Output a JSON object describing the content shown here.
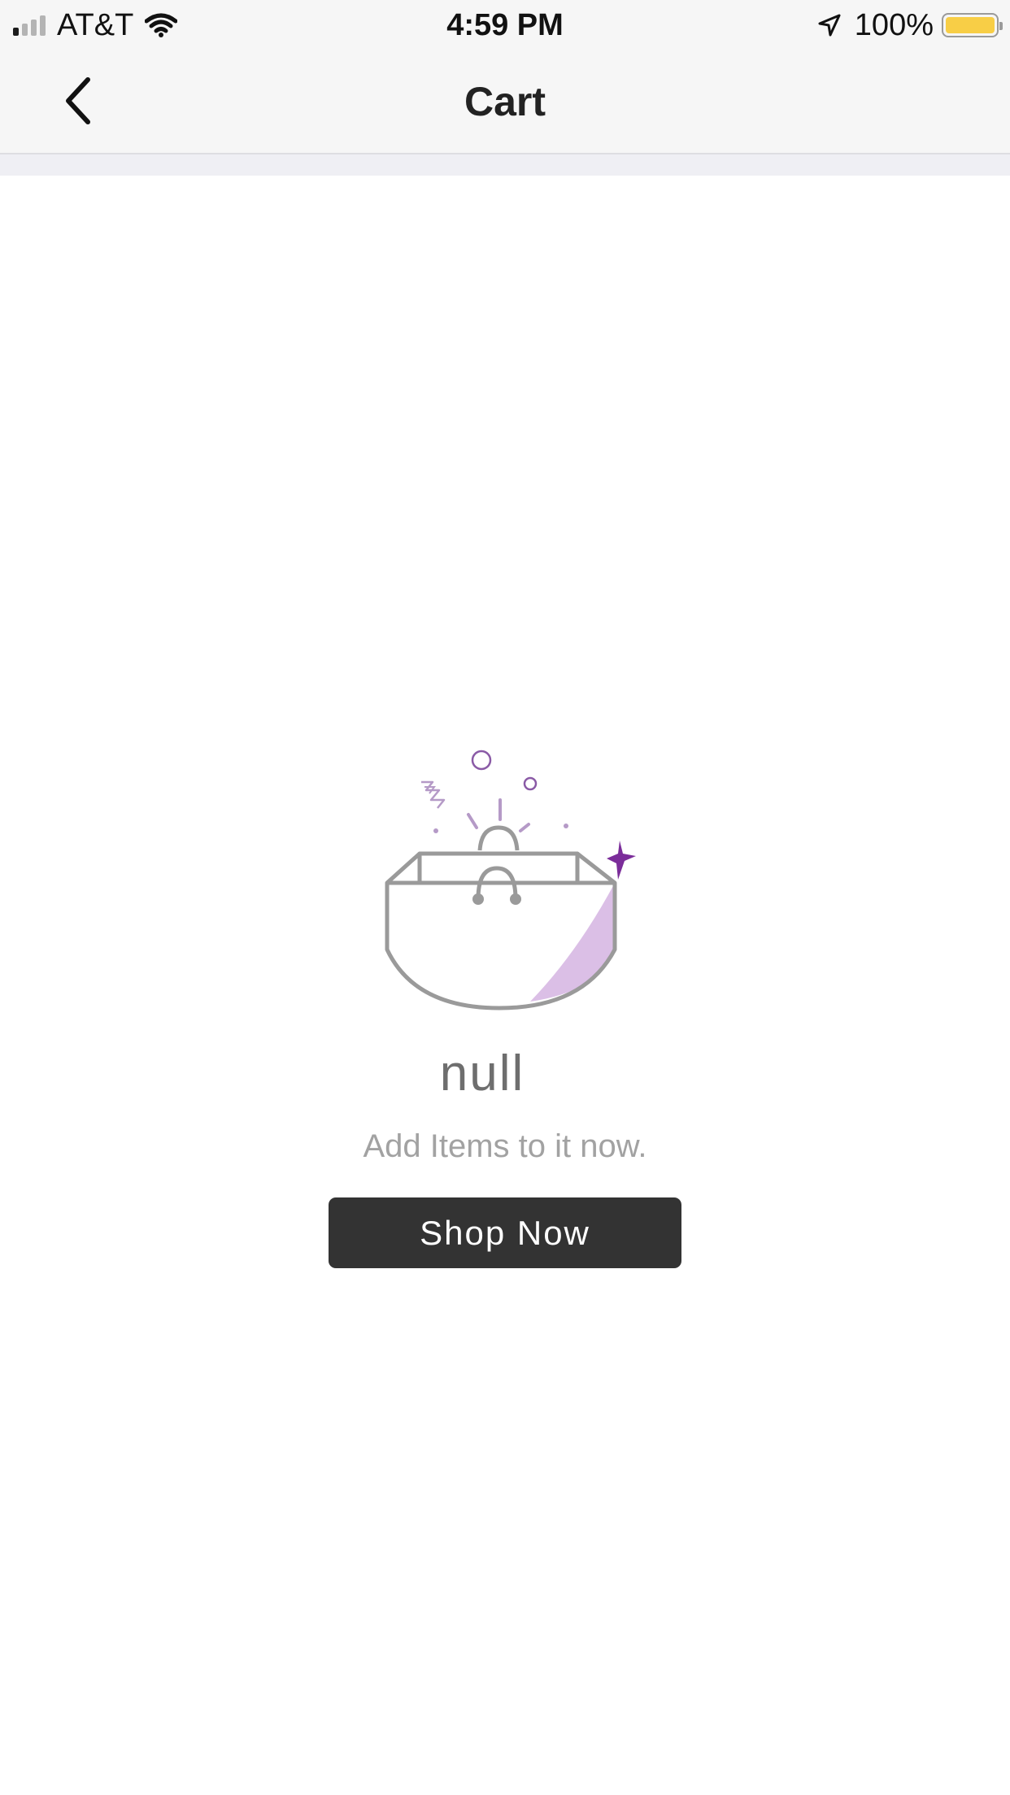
{
  "status_bar": {
    "carrier": "AT&T",
    "time": "4:59 PM",
    "battery_percent": "100%",
    "signal_bars": 4,
    "signal_bars_active": 1,
    "battery_color": "#f8ce46"
  },
  "nav": {
    "title": "Cart",
    "back_icon": "chevron-left-icon"
  },
  "empty_state": {
    "illustration_icon": "empty-shopping-bag-icon",
    "title": "null",
    "subtitle": "Add Items to it now.",
    "accent_color": "#7b2d9a"
  },
  "actions": {
    "shop_now_label": "Shop Now",
    "button_color": "#333333"
  }
}
